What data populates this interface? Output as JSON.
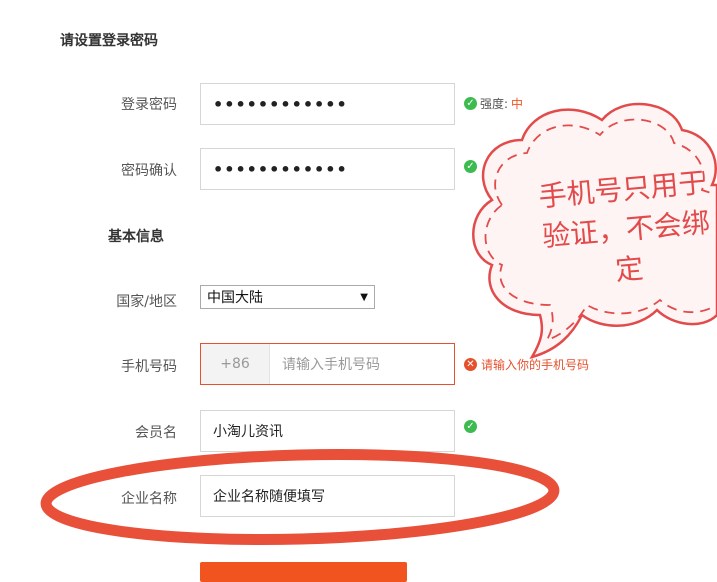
{
  "form": {
    "section_password": "请设置登录密码",
    "password_label": "登录密码",
    "password_value": "••••••••••••",
    "strength_prefix": "强度:",
    "strength_value": "中",
    "confirm_label": "密码确认",
    "confirm_value": "••••••••••••",
    "section_basic": "基本信息",
    "country_label": "国家/地区",
    "country_value": "中国大陆",
    "phone_label": "手机号码",
    "phone_prefix": "+86",
    "phone_placeholder": "请输入手机号码",
    "phone_error": "请输入你的手机号码",
    "member_label": "会员名",
    "member_value": "小淘儿资讯",
    "company_label": "企业名称",
    "company_value": "企业名称随便填写"
  },
  "annotation": {
    "bubble_text": "手机号只用于验证，不会绑定"
  },
  "colors": {
    "accent": "#f1541f",
    "ok": "#3dbb4f",
    "annotation_red": "#e24b4b"
  }
}
